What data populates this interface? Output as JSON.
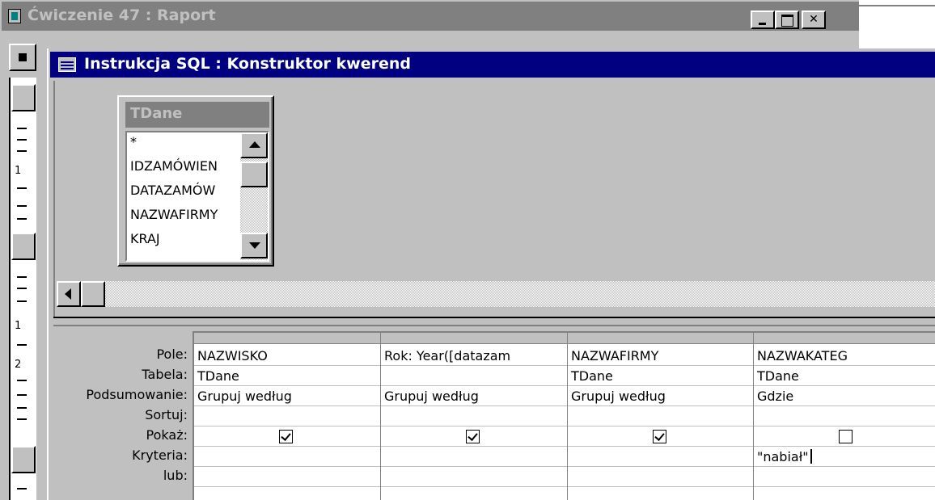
{
  "outer_window": {
    "title": "Ćwiczenie 47 : Raport"
  },
  "ruler": {
    "numbers": [
      "1",
      "1",
      "2"
    ]
  },
  "query_window": {
    "title": "Instrukcja SQL : Konstruktor kwerend"
  },
  "table_box": {
    "title": "TDane",
    "fields": [
      "*",
      "IDZAMÓWIEN",
      "DATAZAMÓW",
      "NAZWAFIRMY",
      "KRAJ"
    ]
  },
  "grid": {
    "row_labels": [
      "Pole:",
      "Tabela:",
      "Podsumowanie:",
      "Sortuj:",
      "Pokaż:",
      "Kryteria:",
      "lub:"
    ],
    "columns": [
      {
        "pole": "NAZWISKO",
        "tabela": "TDane",
        "podsumowanie": "Grupuj według",
        "sortuj": "",
        "pokaz": true,
        "kryteria": "",
        "lub": ""
      },
      {
        "pole": "Rok: Year([datazam",
        "tabela": "",
        "podsumowanie": "Grupuj według",
        "sortuj": "",
        "pokaz": true,
        "kryteria": "",
        "lub": ""
      },
      {
        "pole": "NAZWAFIRMY",
        "tabela": "TDane",
        "podsumowanie": "Grupuj według",
        "sortuj": "",
        "pokaz": true,
        "kryteria": "",
        "lub": ""
      },
      {
        "pole": "NAZWAKATEG",
        "tabela": "TDane",
        "podsumowanie": "Gdzie",
        "sortuj": "",
        "pokaz": false,
        "kryteria": "\"nabiał\"",
        "lub": ""
      }
    ]
  },
  "colors": {
    "active_title": "#000080",
    "inactive_title": "#808080",
    "face": "#c0c0c0"
  }
}
